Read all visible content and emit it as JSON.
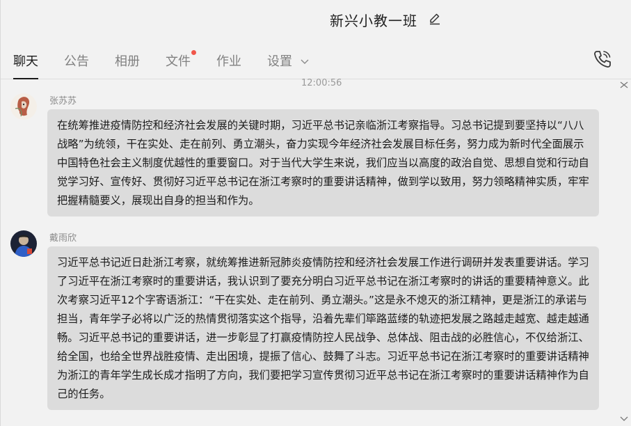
{
  "header": {
    "title": "新兴小教一班",
    "edit_icon": "pencil-icon"
  },
  "tabs": [
    {
      "label": "聊天",
      "active": true
    },
    {
      "label": "公告"
    },
    {
      "label": "相册"
    },
    {
      "label": "文件",
      "has_badge": true
    },
    {
      "label": "作业"
    },
    {
      "label": "设置"
    }
  ],
  "toolbar": {
    "call_icon": "phone-icon"
  },
  "chat": {
    "timestamp": "12:00:56",
    "messages": [
      {
        "sender": "张苏苏",
        "text": "在统筹推进疫情防控和经济社会发展的关键时期，习近平总书记亲临浙江考察指导。习总书记提到要坚持以“八八战略”为统领，干在实处、走在前列、勇立潮头，奋力实现今年经济社会发展目标任务，努力成为新时代全面展示中国特色社会主义制度优越性的重要窗口。对于当代大学生来说，我们应当以高度的政治自觉、思想自觉和行动自觉学习好、宣传好、贯彻好习近平总书记在浙江考察时的重要讲话精神，做到学以致用，努力领略精神实质，牢牢把握精髓要义，展现出自身的担当和作为。"
      },
      {
        "sender": "戴雨欣",
        "text": "习近平总书记近日赴浙江考察，就统筹推进新冠肺炎疫情防控和经济社会发展工作进行调研并发表重要讲话。学习了习近平在浙江考察时的重要讲话，我认识到了要充分明白习近平总书记在浙江考察时的讲话的重要精神意义。此次考察习近平12个字寄语浙江：“干在实处、走在前列、勇立潮头。”这是永不熄灭的浙江精神，更是浙江的承诺与担当，青年学子必将以广泛的热情贯彻落实这个指导，沿着先辈们筚路蓝缕的轨迹把发展之路越走越宽、越走越通畅。习近平总书记的重要讲话，进一步彰显了打赢疫情防控人民战争、总体战、阻击战的必胜信心，不仅给浙江、给全国，也给全世界战胜疫情、走出困境，提振了信心、鼓舞了斗志。习近平总书记在浙江考察时的重要讲话精神为浙江的青年学生成长成才指明了方向，我们要把学习宣传贯彻习近平总书记在浙江考察时的重要讲话精神作为自己的任务。"
      }
    ]
  }
}
